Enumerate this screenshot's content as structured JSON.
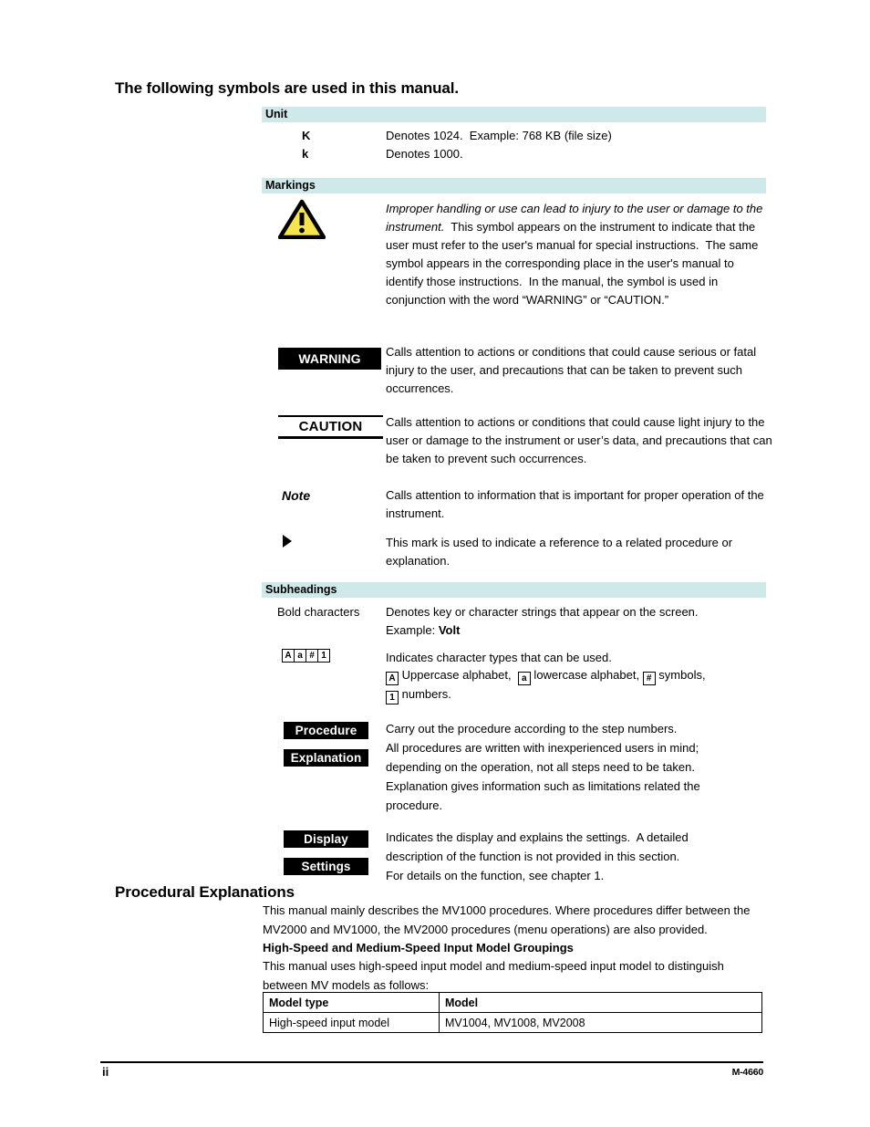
{
  "page": {
    "title": "The following symbols are used in this manual.",
    "procedural_title": "Procedural Explanations",
    "footer": {
      "page_number": "ii",
      "document_code": "M-4660"
    },
    "band_color": "#cfe8ea"
  },
  "sections": {
    "unit": {
      "band_label": "Unit",
      "rows": [
        {
          "term": "K",
          "desc": "Denotes 1024.  Example: 768 KB (file size)"
        },
        {
          "term": "k",
          "desc": "Denotes 1000."
        }
      ]
    },
    "markings": {
      "band_label": "Markings",
      "triangle": {
        "icon": "warning-triangle-icon",
        "fill": "#f5e44c",
        "stroke": "#000000"
      },
      "triangle_desc_italic": "Improper handling or use can lead to injury to the user or damage to the instrument.",
      "triangle_desc_rest": "  This symbol appears on the instrument to indicate that the user must refer to the user's manual for special instructions.  The same symbol appears in the corresponding place in the user's manual to identify those instructions.  In the manual, the symbol is used in conjunction with the word “WARNING” or “CAUTION.”",
      "warning": {
        "label": "WARNING",
        "desc": "Calls attention to actions or conditions that could cause serious or fatal injury to the user, and precautions that can be taken to prevent such occurrences."
      },
      "caution": {
        "label": "CAUTION",
        "desc": "Calls attention to actions or conditions that could cause light injury to the user or damage to the instrument or user’s data, and precautions that can be taken to prevent such occurrences."
      },
      "note": {
        "label": "Note",
        "desc": "Calls attention to information that is important for proper operation of the instrument."
      },
      "reference": {
        "icon": "right-triangle-arrow-icon",
        "desc": "This mark is used to indicate a reference to a related procedure or explanation."
      }
    },
    "subheadings": {
      "band_label": "Subheadings",
      "bold_characters": {
        "label": "Bold characters",
        "desc_line1": "Denotes key or character strings that appear on the screen.",
        "desc_line2_prefix": "Example: ",
        "desc_line2_bold": "Volt"
      },
      "char_types": {
        "boxes": [
          "A",
          "a",
          "#",
          "1"
        ],
        "desc_line1": "Indicates character types that can be used.",
        "line2": {
          "box_a": "A",
          "text_a": " Uppercase alphabet,  ",
          "box_b": "a",
          "text_b": " lowercase alphabet, ",
          "box_c": "#",
          "text_c": " symbols,"
        },
        "line3": {
          "box_d": "1",
          "text_d": " numbers."
        }
      },
      "procedure": {
        "label_procedure": "Procedure",
        "label_explanation": "Explanation",
        "desc": "Carry out the procedure according to the step numbers.\nAll procedures are written with inexperienced users in mind;\ndepending on the operation, not all steps need to be taken.\nExplanation gives information such as limitations related the\nprocedure."
      },
      "display": {
        "label_display": "Display",
        "label_settings": "Settings",
        "desc": "Indicates the display and explains the settings.  A detailed\ndescription of the function is not provided in this section.\nFor details on the function, see chapter 1."
      }
    },
    "procedural": {
      "intro": "This manual mainly describes the MV1000 procedures. Where procedures differ between the MV2000 and MV1000, the MV2000 procedures (menu operations) are also provided.",
      "subheading": "High-Speed and Medium-Speed Input Model Groupings",
      "body": "This manual uses high-speed input model and medium-speed input model to distinguish between MV models as follows:",
      "table": {
        "headers": [
          "Model type",
          "Model"
        ],
        "rows": [
          [
            "High-speed input model",
            "MV1004, MV1008, MV2008"
          ]
        ]
      }
    }
  }
}
